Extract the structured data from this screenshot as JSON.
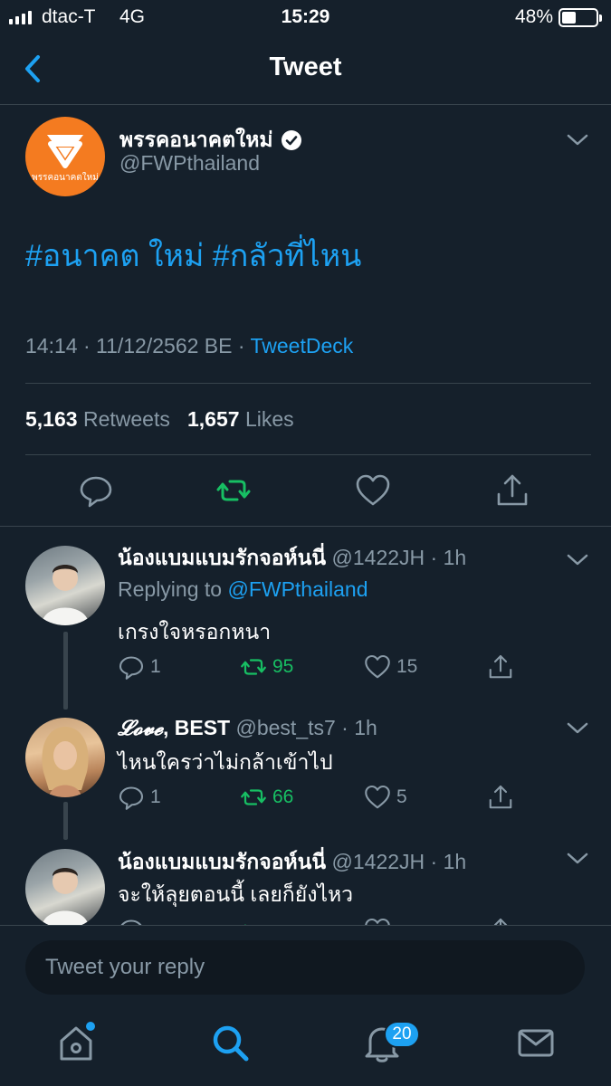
{
  "status_bar": {
    "carrier": "dtac-T",
    "network": "4G",
    "time": "15:29",
    "battery_percent": "48%",
    "battery_level": 0.48
  },
  "header": {
    "title": "Tweet",
    "back_icon": "chevron-left-icon"
  },
  "main_tweet": {
    "display_name": "พรรคอนาคตใหม่",
    "handle": "@FWPthailand",
    "avatar_text": "พรรคอนาคตใหม่",
    "verified": true,
    "text": "#อนาคต ใหม่ #กลัวที่ไหน",
    "timestamp": "14:14 · 11/12/2562 BE · ",
    "via": "TweetDeck",
    "retweets_count": "5,163",
    "retweets_label": "Retweets",
    "likes_count": "1,657",
    "likes_label": "Likes"
  },
  "replies": [
    {
      "display_name": "น้องแบมแบมรักจอห์นนี่",
      "handle": "@1422JH",
      "age": "1h",
      "replying_prefix": "Replying to ",
      "replying_to": "@FWPthailand",
      "text": "เกรงใจหรอกหนา",
      "reply_count": "1",
      "retweet_count": "95",
      "like_count": "15"
    },
    {
      "display_name_script": "𝓛𝓸𝓿𝓮",
      "display_name": ", BEST",
      "handle": "@best_ts7",
      "age": "1h",
      "text": "ไหนใครว่าไม่กล้าเข้าไป",
      "reply_count": "1",
      "retweet_count": "66",
      "like_count": "5"
    },
    {
      "display_name": "น้องแบมแบมรักจอห์นนี่",
      "handle": "@1422JH",
      "age": "1h",
      "text": "จะให้ลุยตอนนี้ เลยก็ยังไหว"
    }
  ],
  "compose": {
    "placeholder": "Tweet your reply"
  },
  "tab_bar": {
    "notifications_badge": "20",
    "items": [
      "home-icon",
      "search-icon",
      "bell-icon",
      "mail-icon"
    ]
  },
  "colors": {
    "background": "#15202b",
    "accent": "#1da1f2",
    "retweet_green": "#17bf63",
    "muted": "#8899a6",
    "brand_orange": "#f47b20"
  }
}
